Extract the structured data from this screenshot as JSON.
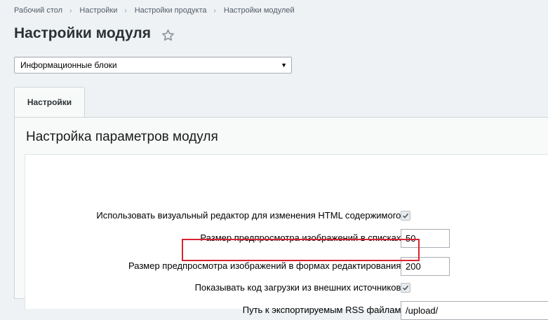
{
  "breadcrumb": {
    "items": [
      "Рабочий стол",
      "Настройки",
      "Настройки продукта",
      "Настройки модулей"
    ],
    "separator": "›"
  },
  "page": {
    "title": "Настройки модуля"
  },
  "module_select": {
    "selected": "Информационные блоки"
  },
  "tabs": [
    {
      "label": "Настройки",
      "active": true
    }
  ],
  "panel": {
    "heading": "Настройка параметров модуля",
    "fields": [
      {
        "label": "Использовать визуальный редактор для изменения HTML содержимого:",
        "type": "checkbox",
        "checked": true
      },
      {
        "label": "Размер предпросмотра изображений в списках:",
        "type": "text",
        "value": "50"
      },
      {
        "label": "Размер предпросмотра изображений в формах редактирования:",
        "type": "text",
        "value": "200"
      },
      {
        "label": "Показывать код загрузки из внешних источников:",
        "type": "checkbox",
        "checked": true,
        "highlighted": true
      },
      {
        "label": "Путь к экспортируемым RSS файлам:",
        "type": "text",
        "value": "/upload/"
      }
    ]
  },
  "colors": {
    "highlight": "#d9232f",
    "background": "#eef2f4",
    "panel": "#f8fafa"
  }
}
